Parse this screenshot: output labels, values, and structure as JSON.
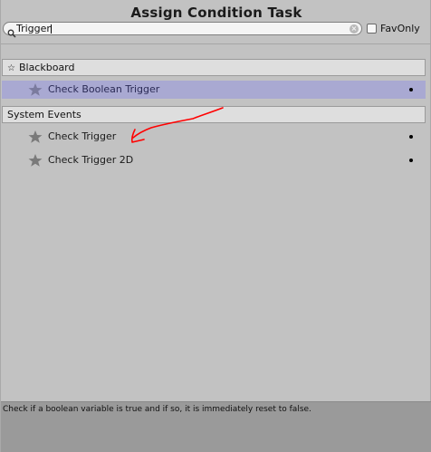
{
  "window": {
    "title": "Assign Condition Task"
  },
  "search": {
    "value": "Trigger",
    "clear_symbol": "×",
    "fav_only_label": "FavOnly",
    "fav_only_checked": false
  },
  "categories": [
    {
      "label": "Blackboard",
      "icon": "star-icon",
      "items": [
        {
          "label": "Check Boolean Trigger",
          "selected": true
        }
      ]
    },
    {
      "label": "System Events",
      "items": [
        {
          "label": "Check Trigger",
          "selected": false
        },
        {
          "label": "Check Trigger 2D",
          "selected": false
        }
      ]
    }
  ],
  "description": "Check if a boolean variable is true and if so, it is immediately reset to false.",
  "colors": {
    "background": "#c2c2c2",
    "selected_row": "#a9a9d2",
    "header_bg": "#dedede",
    "description_bg": "#9a9a9a",
    "annotation": "#ff0000"
  }
}
